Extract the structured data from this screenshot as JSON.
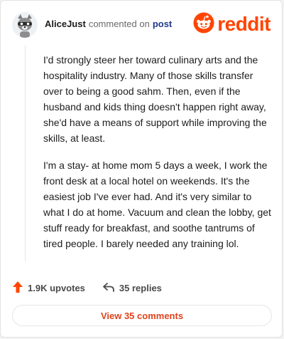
{
  "header": {
    "author": "AliceJust",
    "verb": "commented on",
    "post_link": "post",
    "logo_text": "reddit",
    "avatar_icon": "raccoon-avatar-icon",
    "logo_icon": "reddit-snoo-icon"
  },
  "comment": {
    "paragraphs": [
      "I'd strongly steer her toward culinary arts and the hospitality industry. Many of those skills transfer over to being a good sahm. Then, even if the husband and kids thing doesn't happen right away, she'd have a means of support while improving the skills, at least.",
      "I'm a stay- at home mom 5 days a week, I work the front desk at a local hotel on weekends. It's the easiest job I've ever had. And it's very similar to what I do at home. Vacuum and clean the lobby, get stuff ready for breakfast, and soothe tantrums of tired people. I barely needed any training lol."
    ]
  },
  "footer": {
    "upvotes": "1.9K upvotes",
    "replies": "35 replies",
    "view_button": "View 35 comments",
    "upvote_icon": "upvote-arrow-icon",
    "reply_icon": "reply-arrow-icon"
  },
  "colors": {
    "brand": "#ff4500",
    "link": "#1f3a8a",
    "button_text": "#e0431c"
  }
}
